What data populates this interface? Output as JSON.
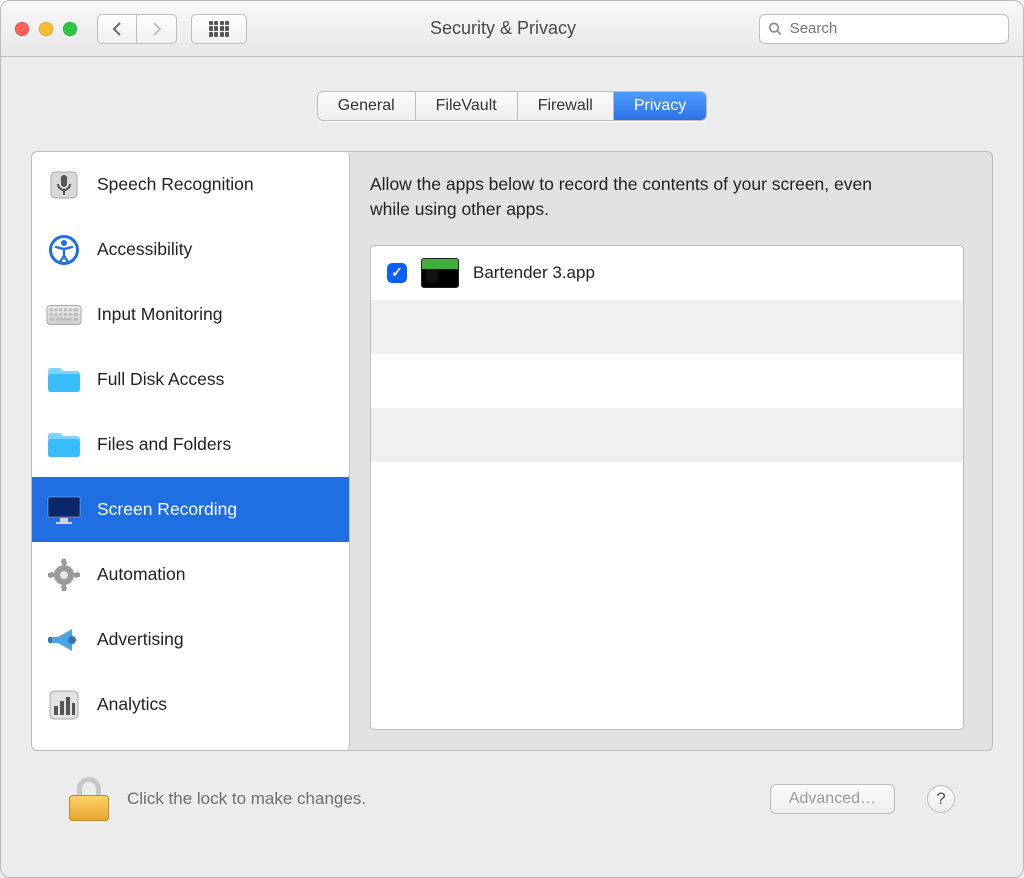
{
  "window": {
    "title": "Security & Privacy"
  },
  "search": {
    "placeholder": "Search"
  },
  "tabs": [
    {
      "label": "General"
    },
    {
      "label": "FileVault"
    },
    {
      "label": "Firewall"
    },
    {
      "label": "Privacy",
      "active": true
    }
  ],
  "sidebar": {
    "items": [
      {
        "label": "Speech Recognition",
        "icon": "mic-icon"
      },
      {
        "label": "Accessibility",
        "icon": "accessibility-icon"
      },
      {
        "label": "Input Monitoring",
        "icon": "keyboard-icon"
      },
      {
        "label": "Full Disk Access",
        "icon": "folder-icon"
      },
      {
        "label": "Files and Folders",
        "icon": "folder-icon"
      },
      {
        "label": "Screen Recording",
        "icon": "display-icon",
        "active": true
      },
      {
        "label": "Automation",
        "icon": "gear-icon"
      },
      {
        "label": "Advertising",
        "icon": "megaphone-icon"
      },
      {
        "label": "Analytics",
        "icon": "barchart-icon"
      }
    ]
  },
  "main": {
    "description": "Allow the apps below to record the contents of your screen, even while using other apps.",
    "apps": [
      {
        "name": "Bartender 3.app",
        "checked": true
      }
    ]
  },
  "footer": {
    "lock_text": "Click the lock to make changes.",
    "advanced_label": "Advanced…"
  }
}
